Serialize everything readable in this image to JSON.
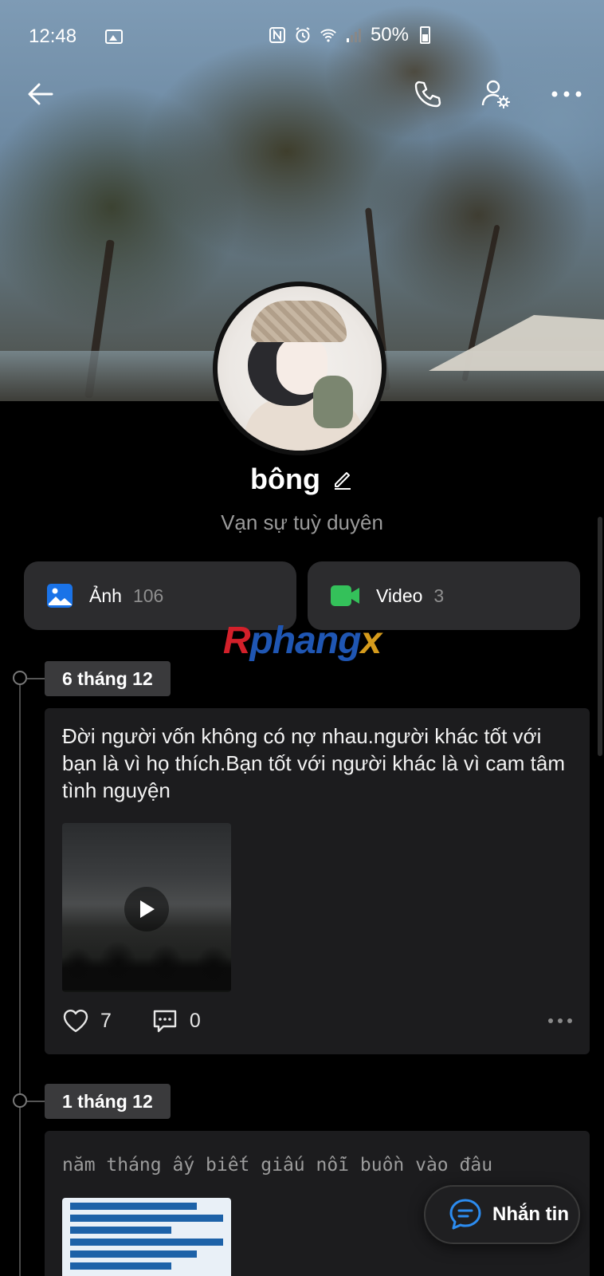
{
  "status_bar": {
    "time": "12:48",
    "battery": "50%"
  },
  "profile": {
    "name": "bông",
    "bio": "Vạn sự tuỳ duyên"
  },
  "media": {
    "photos": {
      "label": "Ảnh",
      "count": "106"
    },
    "videos": {
      "label": "Video",
      "count": "3"
    }
  },
  "watermark": {
    "part1": "R",
    "part2": "phang",
    "part3": "x"
  },
  "posts": [
    {
      "date": "6 tháng 12",
      "text": "Đời người vốn không có nợ nhau.người khác tốt với bạn là vì họ thích.Bạn tốt với người khác là vì cam tâm tình nguyện",
      "likes": "7",
      "comments": "0"
    },
    {
      "date": "1 tháng 12",
      "text": "năm tháng ấy biết giấu nỗi buồn vào đâu"
    }
  ],
  "message_button": {
    "label": "Nhắn tin"
  },
  "colors": {
    "background": "#000000",
    "card": "#2c2c2e",
    "post_card": "#1c1c1e",
    "photo_icon": "#1a73e8",
    "video_icon": "#34c15a",
    "message_icon": "#2c8cf0"
  }
}
